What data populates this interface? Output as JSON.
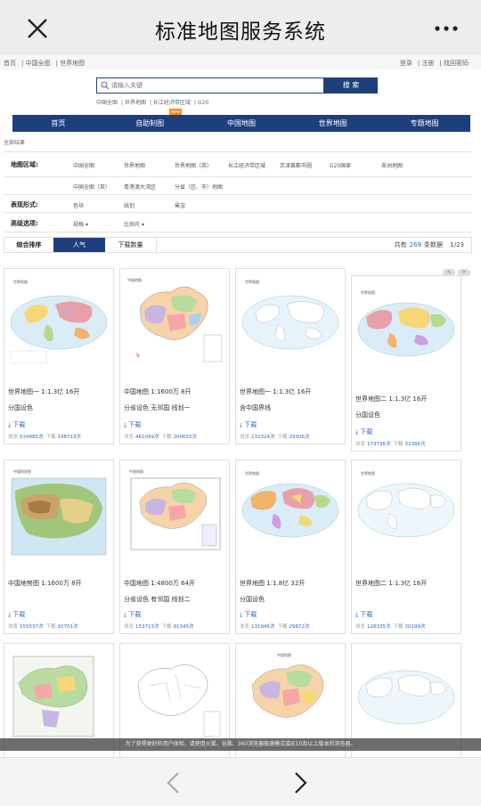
{
  "window": {
    "title": "标准地图服务系统"
  },
  "util": {
    "left": [
      "首页",
      "中国全图",
      "世界地图"
    ],
    "right": [
      "登录",
      "注册",
      "找回密码"
    ]
  },
  "search": {
    "placeholder": "请输入关键",
    "button": "搜 索",
    "quick": [
      "中国全图",
      "世界地图",
      "长江经济带区域",
      "G20"
    ]
  },
  "nav": [
    "首页",
    "自助制图",
    "中国地图",
    "世界地图",
    "专题地图"
  ],
  "nav_badge": "new",
  "crumb": "全部结果",
  "filters": {
    "region_label": "地图区域:",
    "region_row1": [
      "中国全图",
      "世界地图",
      "世界地图（英）",
      "长江经济带区域",
      "京津冀都市圈",
      "G20国家",
      "各洲地图"
    ],
    "region_row2": [
      "中国全图（英）",
      "粤港澳大湾区",
      "分省（区、市）地图"
    ],
    "form_label": "表现形式:",
    "form_opts": [
      "色块",
      "线划",
      "晕渲"
    ],
    "adv_label": "高级选项:",
    "adv_opts": [
      "规格",
      "比例尺"
    ]
  },
  "sort": {
    "tabs": [
      "综合排序",
      "人气",
      "下载数量"
    ],
    "total_prefix": "共有",
    "total": "269",
    "total_suffix": "条数据",
    "page": "1/23"
  },
  "pager": [
    "<",
    ">"
  ],
  "download_label": "下载",
  "views_label": "浏览",
  "downloads_label": "下载",
  "cards": [
    {
      "title": "世界地图一 1:1.3亿 16开",
      "sub": "分国设色",
      "views": "534885次",
      "downloads": "198713次"
    },
    {
      "title": "中国地图 1:1600万 8开",
      "sub": "分省设色 无邻国 线划一",
      "views": "461099次",
      "downloads": "200655次"
    },
    {
      "title": "世界地图一 1:1.3亿 16开",
      "sub": "含中国界线",
      "views": "232324次",
      "downloads": "29306次"
    },
    {
      "title": "世界地图二 1:1.3亿 16开",
      "sub": "分国设色",
      "views": "173736次",
      "downloads": "32386次"
    },
    {
      "title": "中国地势图 1:1600万 8开",
      "sub": "",
      "views": "155537次",
      "downloads": "92701次"
    },
    {
      "title": "中国地图 1:4800万 64开",
      "sub": "分省设色 有邻国 线划二",
      "views": "153713次",
      "downloads": "91345次"
    },
    {
      "title": "世界地图 1:1.8亿 32开",
      "sub": "分国设色",
      "views": "131946次",
      "downloads": "29872次"
    },
    {
      "title": "世界地图二 1:1.3亿 16开",
      "sub": "",
      "views": "126335次",
      "downloads": "20199次"
    }
  ],
  "notice": "为了获得更好的用户体验，请使用火狐、谷歌、360浏览器极速模式或IE10及以上版本的浏览器。",
  "colors": {
    "nav": "#1e3f7d",
    "link": "#2a68c4",
    "badge": "#f08a24"
  }
}
